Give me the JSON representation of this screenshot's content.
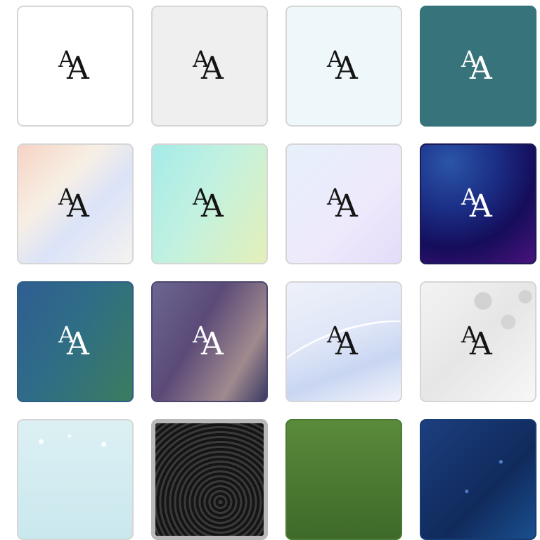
{
  "gallery": {
    "tiles": [
      {
        "label": "A",
        "theme": "white"
      },
      {
        "label": "A",
        "theme": "light-gray"
      },
      {
        "label": "A",
        "theme": "pale-blue"
      },
      {
        "label": "A",
        "theme": "teal"
      },
      {
        "label": "A",
        "theme": "peach-pastel"
      },
      {
        "label": "A",
        "theme": "aqua-lime"
      },
      {
        "label": "A",
        "theme": "lavender"
      },
      {
        "label": "A",
        "theme": "deep-indigo"
      },
      {
        "label": "A",
        "theme": "blue-green"
      },
      {
        "label": "A",
        "theme": "dusk-purple"
      },
      {
        "label": "A",
        "theme": "silver-wave"
      },
      {
        "label": "A",
        "theme": "leafy-white"
      },
      {
        "label": "",
        "theme": "sparkle-cyan"
      },
      {
        "label": "",
        "theme": "black-swirl"
      },
      {
        "label": "",
        "theme": "green-field"
      },
      {
        "label": "",
        "theme": "blue-network"
      }
    ],
    "selected_index": 13
  }
}
